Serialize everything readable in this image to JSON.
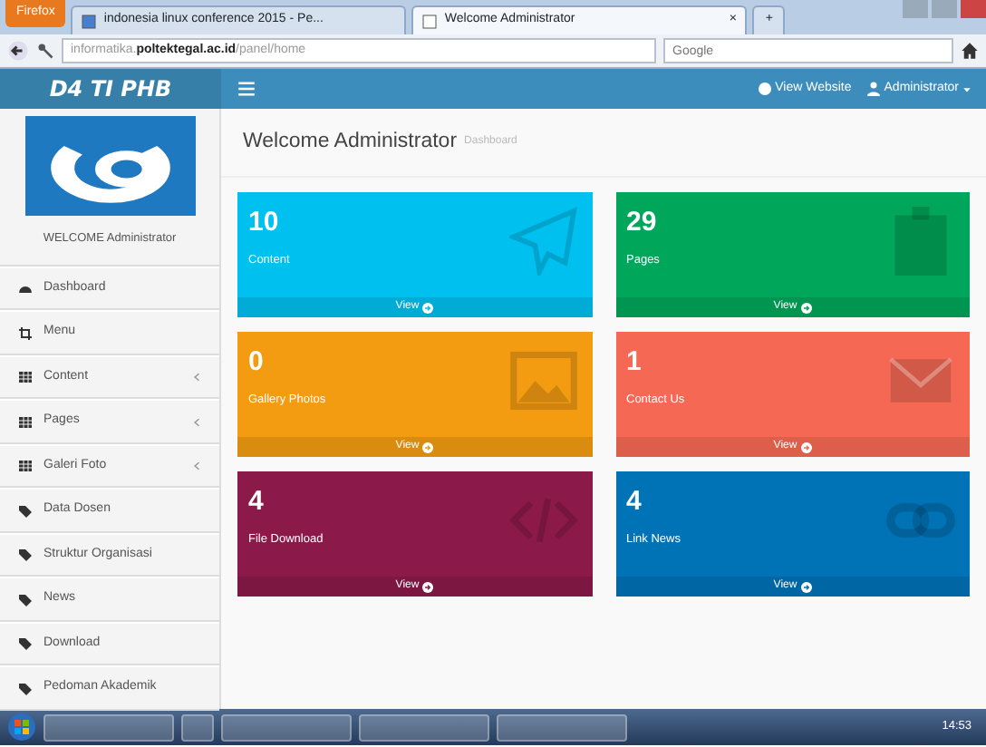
{
  "browser": {
    "menu_button": "Firefox",
    "tabs": [
      {
        "title": "indonesia linux conference 2015 - Pe...",
        "selected": false
      },
      {
        "title": "Welcome Administrator",
        "selected": true
      }
    ],
    "new_tab": "+",
    "close_tab": "×",
    "address": {
      "host_prefix": "informatika.",
      "host": "poltektegal.ac.id",
      "path": "/panel/home"
    },
    "search_placeholder": "Google"
  },
  "navbar": {
    "brand": "D4 TI PHB",
    "view_website": "View Website",
    "user": "Administrator"
  },
  "sidebar": {
    "welcome": "WELCOME Administrator",
    "items": [
      {
        "label": "Dashboard",
        "kind": "dashboard",
        "has_submenu": false
      },
      {
        "label": "Menu",
        "kind": "crop",
        "has_submenu": false
      },
      {
        "label": "Content",
        "kind": "table",
        "has_submenu": true
      },
      {
        "label": "Pages",
        "kind": "table",
        "has_submenu": true
      },
      {
        "label": "Galeri Foto",
        "kind": "table",
        "has_submenu": true
      },
      {
        "label": "Data Dosen",
        "kind": "tag",
        "has_submenu": false
      },
      {
        "label": "Struktur Organisasi",
        "kind": "tag",
        "has_submenu": false
      },
      {
        "label": "News",
        "kind": "tag",
        "has_submenu": false
      },
      {
        "label": "Download",
        "kind": "tag",
        "has_submenu": false
      },
      {
        "label": "Pedoman Akademik",
        "kind": "tag",
        "has_submenu": false
      }
    ]
  },
  "header": {
    "title": "Welcome Administrator",
    "subtitle": "Dashboard"
  },
  "boxes": [
    {
      "count": "10",
      "label": "Content",
      "kind": "plane",
      "color": "#00c0ef",
      "link": "View"
    },
    {
      "count": "29",
      "label": "Pages",
      "kind": "clipboard",
      "color": "#00a65a",
      "link": "View"
    },
    {
      "count": "0",
      "label": "Gallery Photos",
      "kind": "image",
      "color": "#f39c12",
      "link": "View"
    },
    {
      "count": "1",
      "label": "Contact Us",
      "kind": "envelope",
      "color": "#f56954",
      "link": "View"
    },
    {
      "count": "4",
      "label": "File Download",
      "kind": "code",
      "color": "#8b1a4a",
      "link": "View"
    },
    {
      "count": "4",
      "label": "Link News",
      "kind": "link",
      "color": "#0073b7",
      "link": "View"
    }
  ],
  "taskbar": {
    "clock": "14:53"
  }
}
